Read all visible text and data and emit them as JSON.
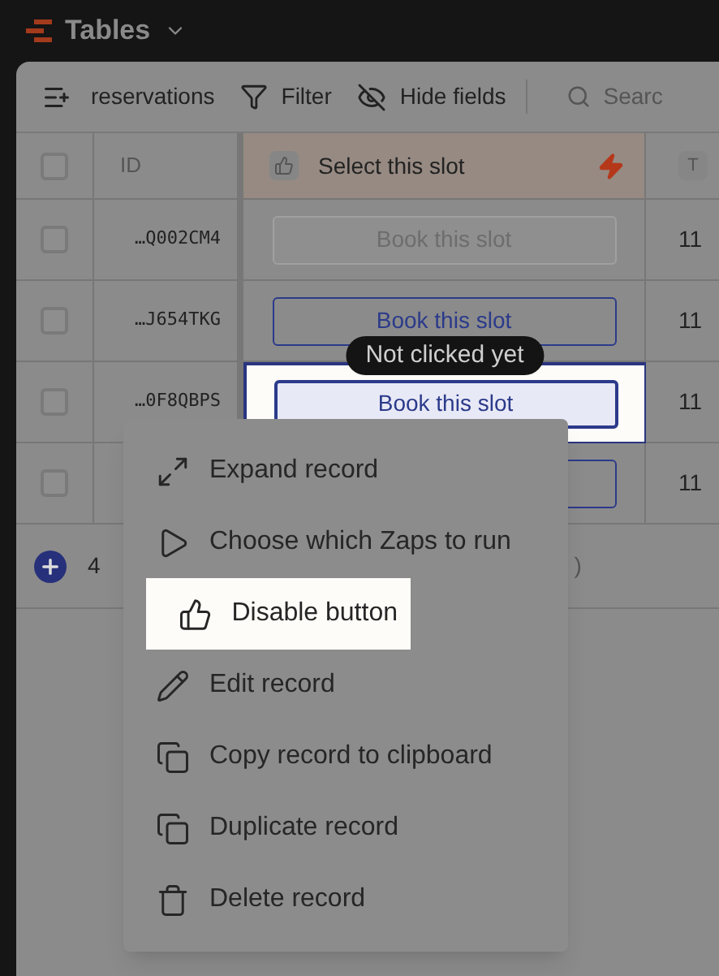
{
  "app": {
    "title": "Tables"
  },
  "toolbar": {
    "table_name": "reservations",
    "filter": "Filter",
    "hide_fields": "Hide fields",
    "search_placeholder": "Searc"
  },
  "columns": [
    {
      "kind": "id",
      "label": "ID"
    },
    {
      "kind": "button",
      "label": "Select this slot"
    },
    {
      "kind": "text",
      "label": "T"
    }
  ],
  "select_all": {
    "checked": false
  },
  "rows": [
    {
      "checked": false,
      "id": "…Q002CM4",
      "button": "Book this slot",
      "disabled": true,
      "selected": false,
      "date": "11"
    },
    {
      "checked": false,
      "id": "…J654TKG",
      "button": "Book this slot",
      "disabled": false,
      "selected": false,
      "date": "11"
    },
    {
      "checked": false,
      "id": "…0F8QBPS",
      "button": "Book this slot",
      "disabled": false,
      "selected": true,
      "date": "11"
    },
    {
      "checked": false,
      "id": "",
      "disabled": false,
      "selected": false,
      "date": "11"
    }
  ],
  "tooltip": "Not clicked yet",
  "footer": {
    "count": "4",
    "suffix": ")"
  },
  "context_menu": [
    {
      "kind": "expand",
      "label": "Expand record",
      "highlighted": false
    },
    {
      "kind": "play",
      "label": "Choose which Zaps to run",
      "highlighted": false
    },
    {
      "kind": "thumb",
      "label": "Disable button",
      "highlighted": true
    },
    {
      "kind": "edit",
      "label": "Edit record",
      "highlighted": false
    },
    {
      "kind": "copy",
      "label": "Copy record to clipboard",
      "highlighted": false
    },
    {
      "kind": "duplicate",
      "label": "Duplicate record",
      "highlighted": false
    },
    {
      "kind": "delete",
      "label": "Delete record",
      "highlighted": false
    }
  ]
}
